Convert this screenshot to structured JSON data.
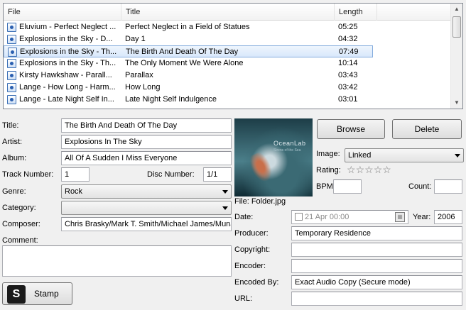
{
  "file_list": {
    "columns": [
      "File",
      "Title",
      "Length"
    ],
    "rows": [
      {
        "file": "Eluvium - Perfect Neglect ...",
        "title": "Perfect Neglect in a Field of Statues",
        "length": "05:25"
      },
      {
        "file": "Explosions in the Sky - D...",
        "title": "Day 1",
        "length": "04:32"
      },
      {
        "file": "Explosions in the Sky - Th...",
        "title": "The Birth And Death Of The Day",
        "length": "07:49"
      },
      {
        "file": "Explosions in the Sky - Th...",
        "title": "The Only Moment We Were Alone",
        "length": "10:14"
      },
      {
        "file": "Kirsty Hawkshaw - Parall...",
        "title": "Parallax",
        "length": "03:43"
      },
      {
        "file": "Lange - How Long - Harm...",
        "title": "How Long",
        "length": "03:42"
      },
      {
        "file": "Lange - Late Night Self In...",
        "title": "Late Night Self Indulgence",
        "length": "03:01"
      }
    ],
    "selected_index": 2
  },
  "form": {
    "title_label": "Title:",
    "title_value": "The Birth And Death Of The Day",
    "artist_label": "Artist:",
    "artist_value": "Explosions In The Sky",
    "album_label": "Album:",
    "album_value": "All Of A Sudden I Miss Everyone",
    "track_label": "Track Number:",
    "track_value": "1",
    "disc_label": "Disc Number:",
    "disc_value": "1/1",
    "genre_label": "Genre:",
    "genre_value": "Rock",
    "category_label": "Category:",
    "category_value": "",
    "composer_label": "Composer:",
    "composer_value": "Chris Brasky/Mark T. Smith/Michael James/Munaf",
    "comment_label": "Comment:",
    "comment_value": ""
  },
  "artwork": {
    "caption": "File: Folder.jpg",
    "cover_title": "OceanLab",
    "cover_subtitle": "Sirens of the Sea",
    "browse_label": "Browse",
    "delete_label": "Delete",
    "image_label": "Image:",
    "image_value": "Linked",
    "rating_label": "Rating:",
    "rating_value": 0,
    "rating_max": 5,
    "bpm_label": "BPM:",
    "bpm_value": "",
    "count_label": "Count:",
    "count_value": ""
  },
  "details": {
    "date_label": "Date:",
    "date_value": "21 Apr  00:00",
    "year_label": "Year:",
    "year_value": "2006",
    "producer_label": "Producer:",
    "producer_value": "Temporary Residence",
    "copyright_label": "Copyright:",
    "copyright_value": "",
    "encoder_label": "Encoder:",
    "encoder_value": "",
    "encoded_by_label": "Encoded By:",
    "encoded_by_value": "Exact Audio Copy   (Secure mode)",
    "url_label": "URL:",
    "url_value": ""
  },
  "stamp_label": "Stamp",
  "colors": {
    "selection_border": "#84acdd",
    "window_bg": "#f0f0f0"
  }
}
